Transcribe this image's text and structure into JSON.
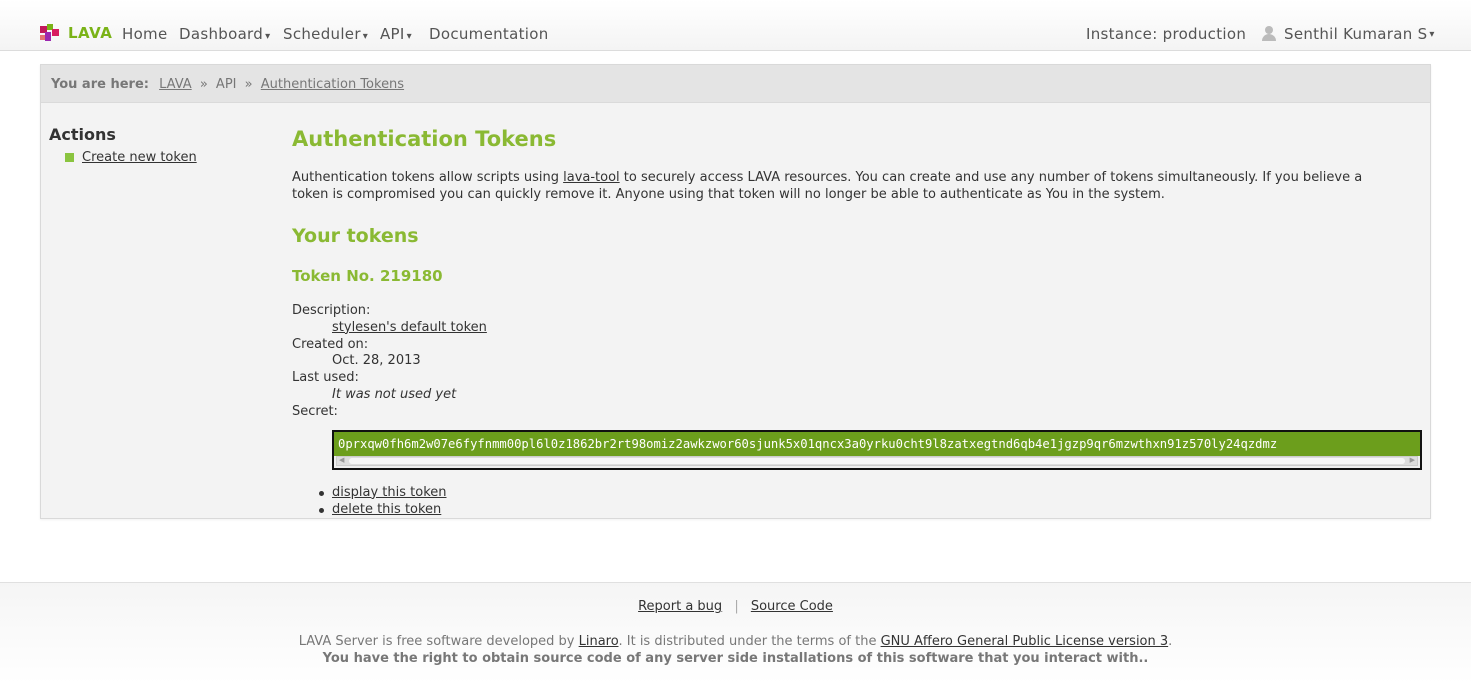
{
  "header": {
    "brand": "LAVA",
    "nav": {
      "home": "Home",
      "dashboard": "Dashboard",
      "scheduler": "Scheduler",
      "api": "API",
      "documentation": "Documentation"
    },
    "caret": "▾",
    "instance": "Instance: production",
    "user": "Senthil Kumaran S"
  },
  "breadcrumb": {
    "prefix": "You are here:",
    "items": [
      "LAVA",
      "API",
      "Authentication Tokens"
    ],
    "separator": "»"
  },
  "sidebar": {
    "title": "Actions",
    "action": "Create new token"
  },
  "main": {
    "title": "Authentication Tokens",
    "intro_part1": "Authentication tokens allow scripts using ",
    "intro_link": "lava-tool",
    "intro_part2": " to securely access LAVA resources. You can create and use any number of tokens simultaneously. If you believe a token is compromised you can quickly remove it. Anyone using that token will no longer be able to authenticate as You in the system.",
    "section_title": "Your tokens",
    "token": {
      "title": "Token No. 219180",
      "description_label": "Description:",
      "description": "stylesen's default token",
      "created_label": "Created on:",
      "created": "Oct. 28, 2013",
      "last_used_label": "Last used:",
      "last_used": "It was not used yet",
      "secret_label": "Secret:",
      "secret": "0prxqw0fh6m2w07e6fyfnmm00pl6l0z1862br2rt98omiz2awkzwor60sjunk5x01qncx3a0yrku0cht9l8zatxegtnd6qb4e1jgzp9qr6mzwthxn91z570ly24qzdmz",
      "display_link": "display this token",
      "delete_link": "delete this token"
    }
  },
  "footer": {
    "report_bug": "Report a bug",
    "source_code": "Source Code",
    "separator": "|",
    "note_part1": "LAVA Server is free software developed by ",
    "note_link1": "Linaro",
    "note_part2": ". It is distributed under the terms of the ",
    "note_link2": "GNU Affero General Public License version 3",
    "note_part3": ".",
    "rights": "You have the right to obtain source code of any server side installations of this software that you interact with.."
  },
  "colors": {
    "accent": "#8ab933",
    "secret_bg": "#6c9e1c"
  }
}
